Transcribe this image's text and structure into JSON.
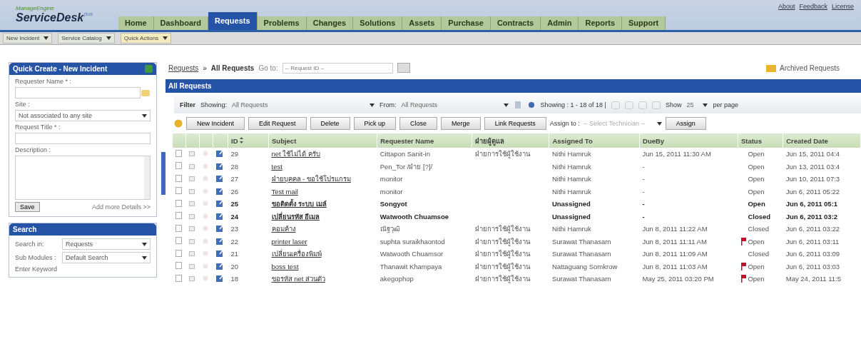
{
  "header": {
    "logo": {
      "vendor": "ManageEngine",
      "product": "ServiceDesk",
      "edition": "plus"
    },
    "top_links": [
      "About",
      "Feedback",
      "License"
    ],
    "tabs": [
      {
        "label": "Home",
        "selected": false
      },
      {
        "label": "Dashboard",
        "selected": false
      },
      {
        "label": "Requests",
        "selected": true
      },
      {
        "label": "Problems",
        "selected": false
      },
      {
        "label": "Changes",
        "selected": false
      },
      {
        "label": "Solutions",
        "selected": false
      },
      {
        "label": "Assets",
        "selected": false
      },
      {
        "label": "Purchase",
        "selected": false
      },
      {
        "label": "Contracts",
        "selected": false
      },
      {
        "label": "Admin",
        "selected": false
      },
      {
        "label": "Reports",
        "selected": false
      },
      {
        "label": "Support",
        "selected": false
      }
    ]
  },
  "sub_toolbar": {
    "menus": [
      {
        "label": "New Incident",
        "kind": "plain"
      },
      {
        "label": "Service Catalog",
        "kind": "plain"
      },
      {
        "label": "Quick Actions",
        "kind": "highlight"
      }
    ]
  },
  "quick_create": {
    "title": "Quick Create - New Incident",
    "requester_label": "Requester Name * :",
    "site_label": "Site :",
    "site_value": "Not associated to any site",
    "title_label": "Request Title * :",
    "description_label": "Description :",
    "save": "Save",
    "more_link": "Add more Details >>"
  },
  "search": {
    "title": "Search",
    "search_in_label": "Search in:",
    "search_in_value": "Requests",
    "sub_modules_label": "Sub Modules :",
    "sub_modules_value": "Default Search",
    "keyword_label": "Enter Keyword"
  },
  "breadcrumb": {
    "link": "Requests",
    "separator": "»",
    "current": "All Requests"
  },
  "go_to": {
    "label": "Go to:",
    "placeholder": "-- Request ID --"
  },
  "archived_link": "Archived Requests",
  "panel_title": "All Requests",
  "filter": {
    "label": "Filter",
    "showing_label": "Showing:",
    "showing_value": "All Requests",
    "from_label": "From:",
    "from_value": "All Requests",
    "count": "Showing : 1 - 18 of 18 |",
    "show_label": "Show",
    "per_page_value": "25",
    "per_page_label": "per page"
  },
  "actions": {
    "buttons": [
      "New Incident",
      "Edit Request",
      "Delete",
      "Pick up",
      "Close",
      "Merge",
      "Link Requests"
    ],
    "assign_label": "Assign to :",
    "technician_placeholder": "-- Select Technician --",
    "assign_button": "Assign"
  },
  "columns": [
    "ID",
    "Subject",
    "Requester Name",
    "ฝ่ายผู้ดูแล",
    "Assigned To",
    "DueBy",
    "Status",
    "Created Date"
  ],
  "rows": [
    {
      "id": "29",
      "subject": "net ใช้ไม่ได้ ครับ",
      "requester": "Cittapon Sanit-in",
      "group": "ฝ่ายการใช้ผู้ใช้งาน",
      "assigned": "Nithi Hamruk",
      "due": "Jun 15, 2011 11:30 AM",
      "status": "Open",
      "created": "Jun 15, 2011 04:4",
      "checked": false,
      "unread": false,
      "flagged": false
    },
    {
      "id": "28",
      "subject": "test",
      "requester": "Pen_Tor /ฝ่าย [?]/",
      "group": "",
      "assigned": "Nithi Hamruk",
      "due": "-",
      "status": "Open",
      "created": "Jun 13, 2011 03:4",
      "checked": false,
      "unread": false,
      "flagged": false
    },
    {
      "id": "27",
      "subject": "ฝ่ายบุคคล - ขอใช้โปรแกรม",
      "requester": "monitor",
      "group": "",
      "assigned": "Nithi Hamruk",
      "due": "-",
      "status": "Open",
      "created": "Jun 10, 2011 07:3",
      "checked": false,
      "unread": false,
      "flagged": false
    },
    {
      "id": "26",
      "subject": "Test mail",
      "requester": "monitor",
      "group": "",
      "assigned": "Nithi Hamruk",
      "due": "-",
      "status": "Open",
      "created": "Jun 6, 2011 05:22",
      "checked": false,
      "unread": false,
      "flagged": false
    },
    {
      "id": "25",
      "subject": "ขอติดตั้ง ระบบ เมล์",
      "requester": "Songyot",
      "group": "",
      "assigned": "Unassigned",
      "due": "-",
      "status": "Open",
      "created": "Jun 6, 2011 05:1",
      "checked": false,
      "unread": true,
      "flagged": false
    },
    {
      "id": "24",
      "subject": "เปลี่ยนรหัส อีเมล",
      "requester": "Watwooth Chuamsoe",
      "group": "",
      "assigned": "Unassigned",
      "due": "-",
      "status": "Closed",
      "created": "Jun 6, 2011 03:2",
      "checked": false,
      "unread": true,
      "flagged": false
    },
    {
      "id": "23",
      "subject": "คอมค้าง",
      "requester": "ณัฐวุฒิ",
      "group": "ฝ่ายการใช้ผู้ใช้งาน",
      "assigned": "Nithi Hamruk",
      "due": "Jun 8, 2011 11:22 AM",
      "status": "Closed",
      "created": "Jun 6, 2011 03:22",
      "checked": false,
      "unread": false,
      "flagged": false
    },
    {
      "id": "22",
      "subject": "printer laser",
      "requester": "suphta suraikhaontod",
      "group": "ฝ่ายการใช้ผู้ใช้งาน",
      "assigned": "Surawat Thanasarn",
      "due": "Jun 8, 2011 11:11 AM",
      "status": "Open",
      "created": "Jun 6, 2011 03:11",
      "checked": false,
      "unread": false,
      "flagged": true
    },
    {
      "id": "21",
      "subject": "เปลี่ยนเครื่องพิมพ์",
      "requester": "Watwooth Chuamsor",
      "group": "ฝ่ายการใช้ผู้ใช้งาน",
      "assigned": "Surawat Thanasarn",
      "due": "Jun 8, 2011 11:09 AM",
      "status": "Closed",
      "created": "Jun 6, 2011 03:09",
      "checked": false,
      "unread": false,
      "flagged": false
    },
    {
      "id": "20",
      "subject": "boss test",
      "requester": "Thanawit Khampaya",
      "group": "ฝ่ายการใช้ผู้ใช้งาน",
      "assigned": "Nattaguang Somkrow",
      "due": "Jun 8, 2011 11:03 AM",
      "status": "Open",
      "created": "Jun 6, 2011 03:03",
      "checked": false,
      "unread": false,
      "flagged": true
    },
    {
      "id": "18",
      "subject": "ขอรหัส net ส่วนตัว",
      "requester": "akegophop",
      "group": "ฝ่ายการใช้ผู้ใช้งาน",
      "assigned": "Surawat Thanasarn",
      "due": "May 25, 2011 03:20 PM",
      "status": "Open",
      "created": "May 24, 2011 11:5",
      "checked": false,
      "unread": false,
      "flagged": true
    }
  ]
}
